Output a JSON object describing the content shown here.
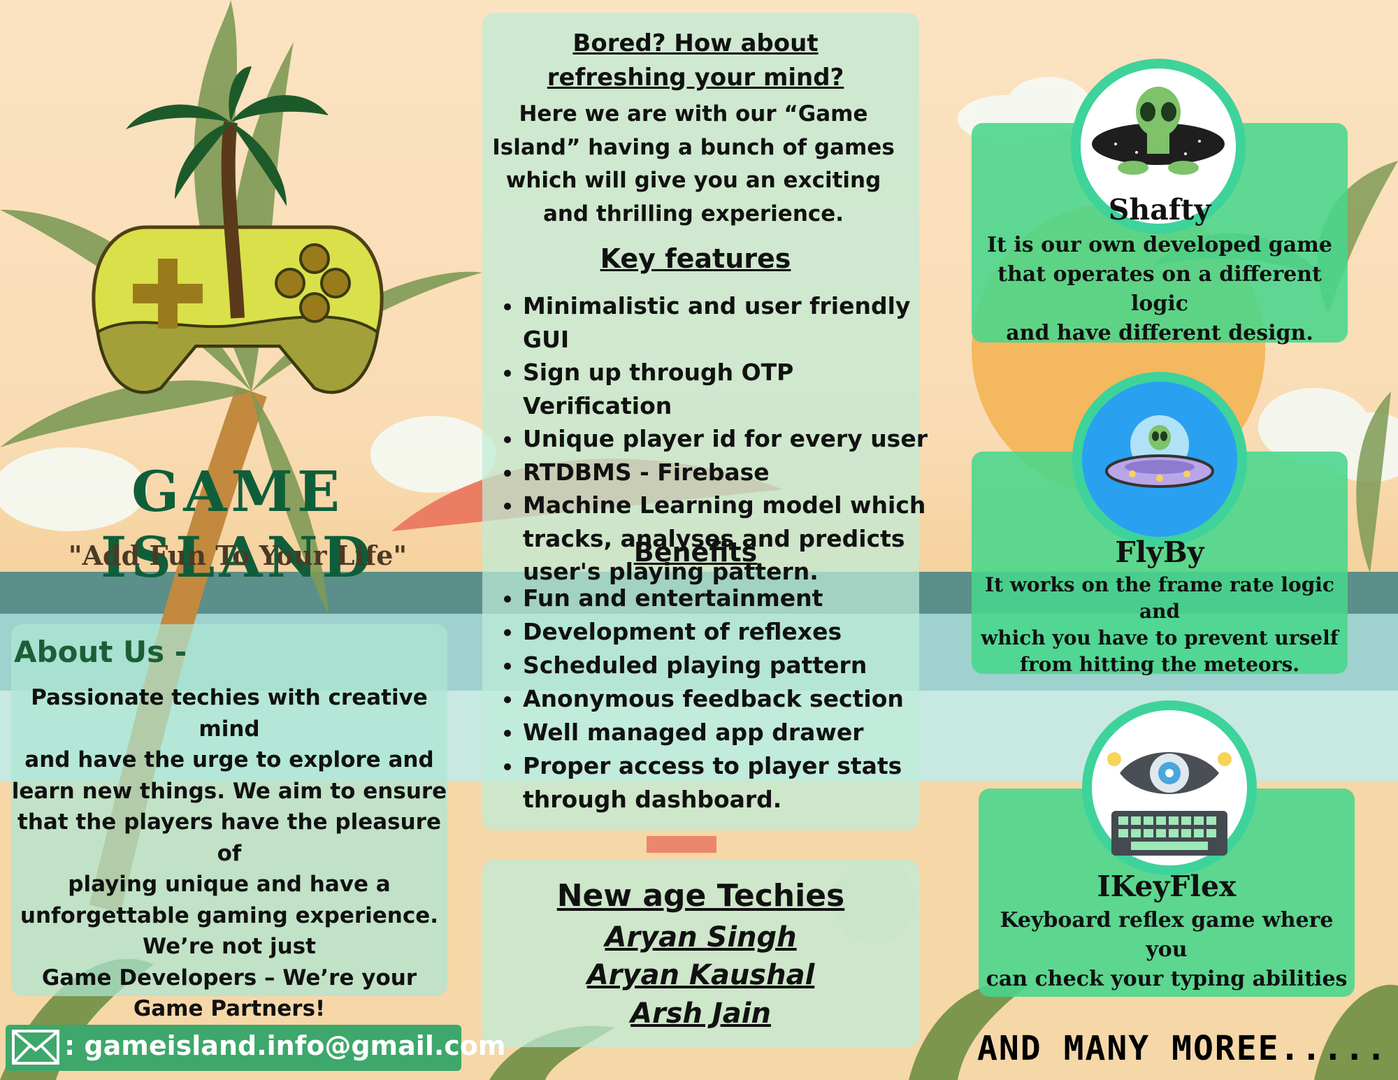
{
  "intro": {
    "heading": "Bored? How about refreshing your mind?",
    "body": "Here we are with our “Game Island” having a bunch of games which will give you an exciting and thrilling experience."
  },
  "features": {
    "title": "Key features",
    "items": [
      "Minimalistic and user friendly GUI",
      "Sign up through OTP Verification",
      "Unique player id for every user",
      "RTDBMS - Firebase",
      "Machine Learning model which tracks, analyses and predicts user's playing  pattern."
    ]
  },
  "benefits": {
    "title": "Benefits",
    "items": [
      "Fun and entertainment",
      "Development of reflexes",
      "Scheduled playing pattern",
      "Anonymous feedback section",
      "Well managed app drawer",
      "Proper  access to player stats through dashboard."
    ]
  },
  "brand": {
    "name": "GAME ISLAND",
    "tagline": "\"Add Fun To Your Life\""
  },
  "about": {
    "title": "About Us -",
    "lines": [
      "Passionate techies with creative mind",
      "and have the urge to explore and",
      "learn new things. We aim to ensure",
      "that the players have the pleasure of",
      "playing unique and have a",
      "unforgettable gaming experience.",
      "We’re not just",
      "Game Developers – We’re your",
      "Game Partners!"
    ]
  },
  "team": {
    "title": "New age Techies",
    "members": [
      "Aryan Singh ",
      "Aryan Kaushal ",
      "Arsh Jain"
    ]
  },
  "contact": {
    "icon": "envelope-icon",
    "email": ": gameisland.info@gmail.com"
  },
  "games": [
    {
      "name": "Shafty",
      "icon": "alien-icon",
      "lines": [
        "It is our own developed game",
        "that operates on a different logic",
        "and have different design."
      ]
    },
    {
      "name": "FlyBy",
      "icon": "ufo-icon",
      "lines": [
        "It works on the frame rate logic and",
        "which you have to prevent urself",
        "from hitting the meteors."
      ]
    },
    {
      "name": "IKeyFlex",
      "icon": "keyboard-eye-icon",
      "lines": [
        "Keyboard reflex game where you",
        "can check your typing abilities"
      ]
    }
  ],
  "footer": {
    "more": "AND MANY MOREE....."
  },
  "colors": {
    "brand_green": "#0f5e3a",
    "card_green": "#48d68c",
    "ring_green": "#3ed39a",
    "panel_mint": "#beebd7",
    "sea_teal": "#5b8f8a"
  }
}
